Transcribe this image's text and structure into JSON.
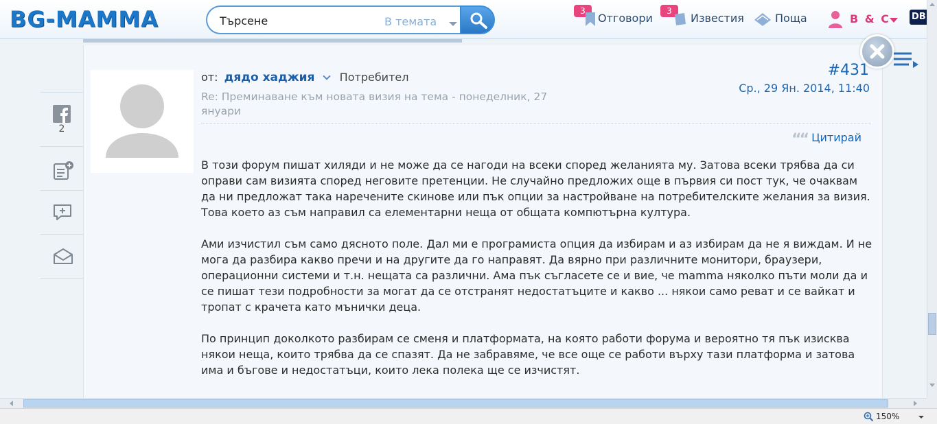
{
  "header": {
    "logo": "BG-MAMMA",
    "search": {
      "placeholder": "Търсене",
      "scope": "В темата"
    },
    "nav": {
      "replies": {
        "label": "Отговори",
        "badge": "3"
      },
      "notifications": {
        "label": "Известия",
        "badge": "3"
      },
      "mail": {
        "label": "Поща"
      }
    },
    "user": {
      "name": "B & C"
    },
    "db_badge": "DB"
  },
  "sidebar": {
    "facebook_count": "2"
  },
  "post": {
    "from_label": "от:",
    "author": "дядо хаджия",
    "role": "Потребител",
    "subject": "Re: Преминаване към новата визия на тема - понеделник, 27 януари",
    "number": "#431",
    "date": "Ср., 29 Ян. 2014, 11:40",
    "quote_label": "Цитирай",
    "paragraphs": [
      "В този форум пишат хиляди и не може да се нагоди на всеки според желанията му. Затова всеки трябва да си оправи сам визията според неговите претенции. Не случайно предложих още в първия си пост тук, че очаквам да ни предложат така наречените скинове или пък опции за настройване на потребителските желания за визия. Това което аз съм направил са елементарни неща от общата компютърна култура.",
      "Ами изчистил съм само дясното поле. Дал ми е програмиста опция да избирам и аз избирам да не я виждам. И не мога да разбира какво пречи и на другите да го направят. Да вярно при различните монитори, браузери, операционни системи и т.н. нещата са различни. Ама пък съгласете се и вие, че mamma няколко пъти моли да и се пишат тези подробности за могат да се отстранят недостатъците и какво ... някои само реват и се вайкат и тропат с крачета като мънички деца.",
      "По принцип доколкото разбирам се сменя и платформата, на която работи форума и вероятно тя пък изисква някои неща, които трябва да се спазят. Да не забравяме, че все още се работи върху тази платформа и затова има и бъгове и недостатъци, които лека полека ще се изчистят."
    ]
  },
  "statusbar": {
    "zoom": "150%"
  },
  "colors": {
    "brand": "#1d77c8",
    "accent_pink": "#e8457e",
    "link": "#1a66b3"
  }
}
